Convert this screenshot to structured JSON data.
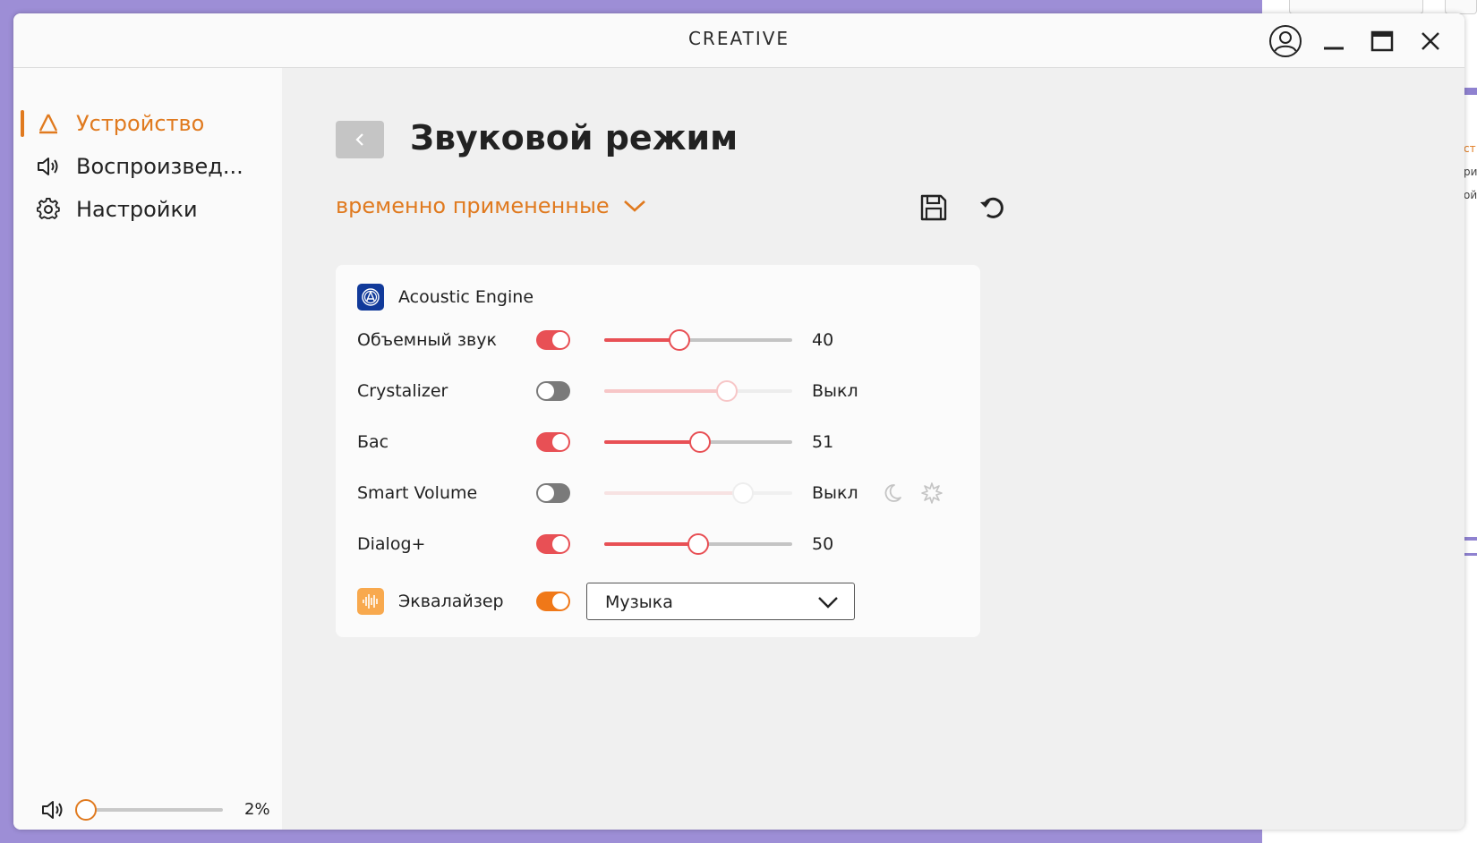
{
  "app": {
    "logo_text": "CREATIVE"
  },
  "background_window": {
    "fragments": [
      "ст",
      "ри",
      "ой"
    ]
  },
  "sidebar": {
    "items": [
      {
        "label": "Устройство",
        "icon": "device-icon",
        "active": true
      },
      {
        "label": "Воспроизвед...",
        "icon": "speaker-icon",
        "active": false
      },
      {
        "label": "Настройки",
        "icon": "gear-icon",
        "active": false
      }
    ],
    "volume": {
      "value_pct": 2,
      "label": "2%"
    }
  },
  "page": {
    "title": "Звуковой режим",
    "preset_label": "временно примененные"
  },
  "acoustic_engine": {
    "header": "Acoustic Engine",
    "rows": [
      {
        "label": "Объемный звук",
        "enabled": true,
        "value": 40,
        "value_label": "40"
      },
      {
        "label": "Crystalizer",
        "enabled": false,
        "value": 65,
        "value_label": "Выкл"
      },
      {
        "label": "Бас",
        "enabled": true,
        "value": 51,
        "value_label": "51"
      },
      {
        "label": "Smart Volume",
        "enabled": false,
        "value": 74,
        "value_label": "Выкл",
        "modes": [
          "moon-icon",
          "burst-icon"
        ]
      },
      {
        "label": "Dialog+",
        "enabled": true,
        "value": 50,
        "value_label": "50"
      }
    ]
  },
  "equalizer": {
    "label": "Эквалайзер",
    "enabled": true,
    "selected": "Музыка"
  },
  "colors": {
    "accent": "#e07a1f",
    "toggle_on": "#e85055",
    "toggle_off": "#7a7a7a",
    "eq_toggle": "#f07818",
    "ae_badge": "#113a9a",
    "eq_badge": "#f8a94e"
  }
}
